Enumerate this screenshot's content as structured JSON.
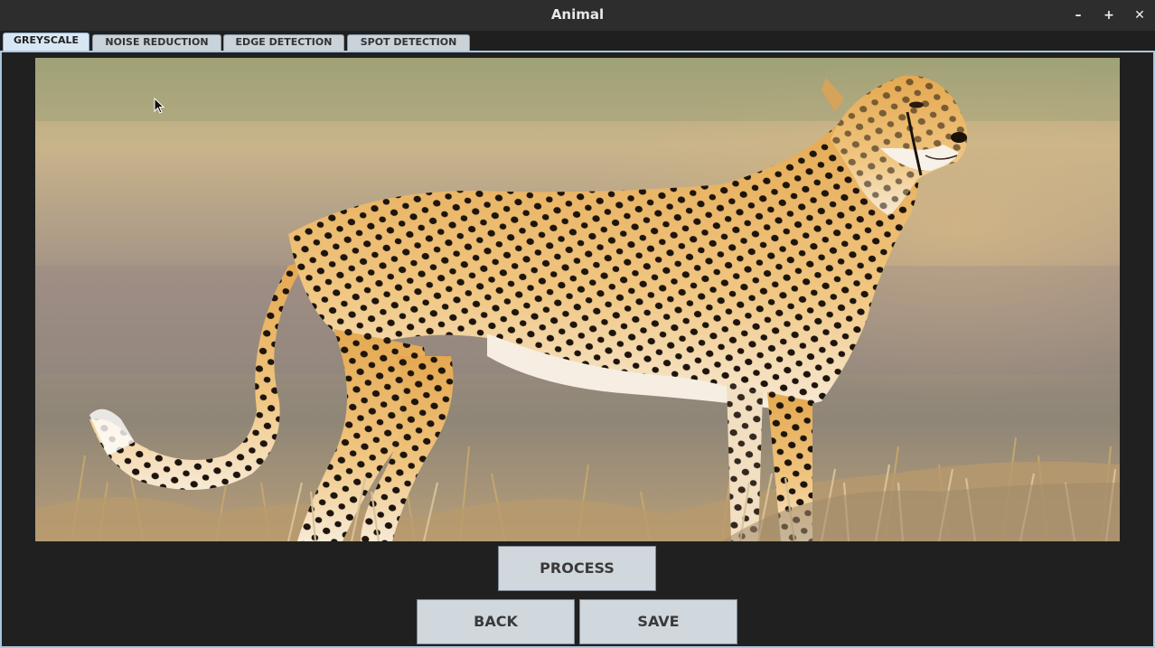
{
  "window": {
    "title": "Animal"
  },
  "window_controls": {
    "minimize": "–",
    "maximize": "+",
    "close": "✕"
  },
  "tabs": [
    {
      "label": "GREYSCALE",
      "active": true
    },
    {
      "label": "NOISE REDUCTION",
      "active": false
    },
    {
      "label": "EDGE DETECTION",
      "active": false
    },
    {
      "label": "SPOT DETECTION",
      "active": false
    }
  ],
  "buttons": {
    "process": "PROCESS",
    "back": "BACK",
    "save": "SAVE"
  },
  "image": {
    "subject": "cheetah",
    "icon": "photo"
  },
  "colors": {
    "titlebar": "#2d2d2d",
    "panel": "#202020",
    "tab_active": "#d9e7f4",
    "button": "#d0d7dd",
    "accent_border": "#a9c6df"
  }
}
